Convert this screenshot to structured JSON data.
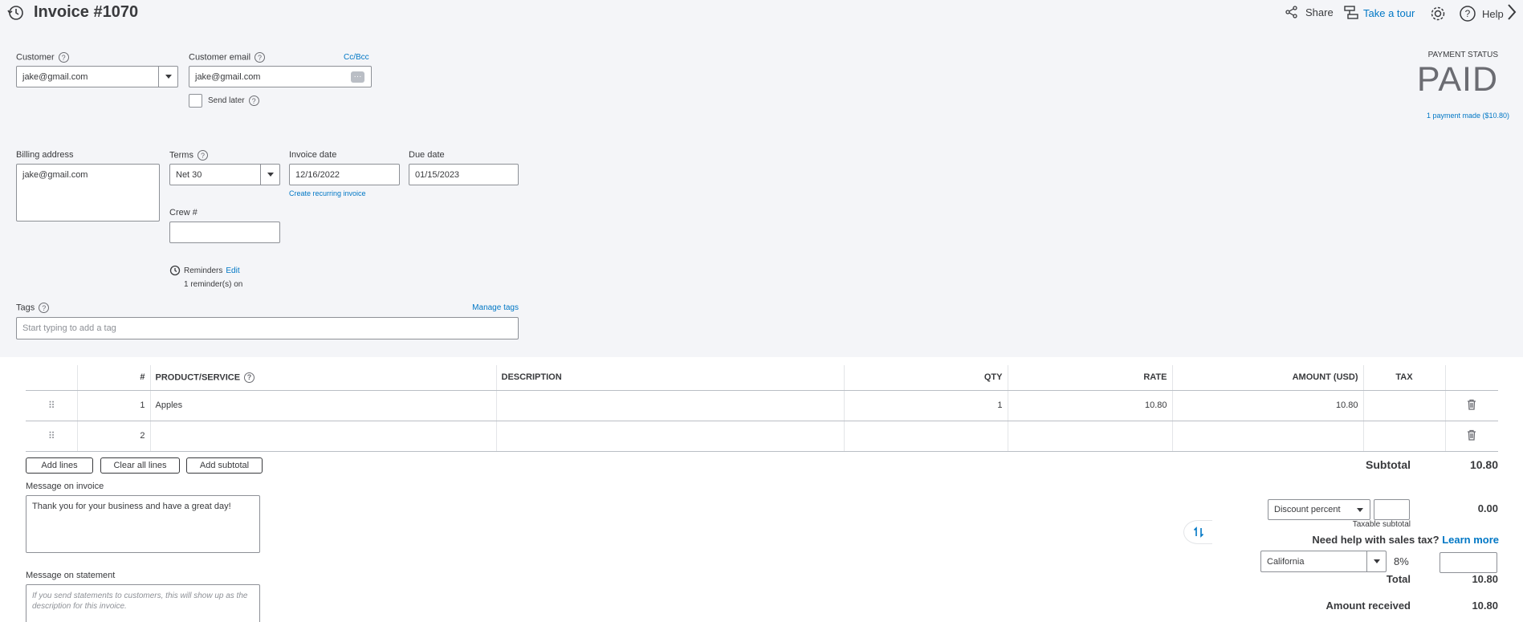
{
  "header": {
    "title": "Invoice #1070",
    "share_label": "Share",
    "tour_label": "Take a tour",
    "help_label": "Help"
  },
  "customer": {
    "label": "Customer",
    "value": "jake@gmail.com"
  },
  "email": {
    "label": "Customer email",
    "cc_bcc": "Cc/Bcc",
    "value": "jake@gmail.com",
    "send_later": "Send later"
  },
  "payment": {
    "status_label": "PAYMENT STATUS",
    "status": "PAID",
    "payments_link": "1 payment made ($10.80)"
  },
  "billing": {
    "label": "Billing address",
    "value": "jake@gmail.com"
  },
  "terms": {
    "label": "Terms",
    "value": "Net 30"
  },
  "invoice_date": {
    "label": "Invoice date",
    "value": "12/16/2022",
    "recurring_link": "Create recurring invoice"
  },
  "due_date": {
    "label": "Due date",
    "value": "01/15/2023"
  },
  "crew": {
    "label": "Crew #",
    "value": ""
  },
  "reminders": {
    "label": "Reminders",
    "edit": "Edit",
    "status": "1 reminder(s) on"
  },
  "tags": {
    "label": "Tags",
    "manage": "Manage tags",
    "placeholder": "Start typing to add a tag"
  },
  "table": {
    "columns": {
      "num": "#",
      "product": "PRODUCT/SERVICE",
      "description": "DESCRIPTION",
      "qty": "QTY",
      "rate": "RATE",
      "amount": "AMOUNT (USD)",
      "tax": "TAX"
    },
    "rows": [
      {
        "num": "1",
        "product": "Apples",
        "description": "",
        "qty": "1",
        "rate": "10.80",
        "amount": "10.80",
        "tax": ""
      },
      {
        "num": "2",
        "product": "",
        "description": "",
        "qty": "",
        "rate": "",
        "amount": "",
        "tax": ""
      }
    ]
  },
  "actions": {
    "add_lines": "Add lines",
    "clear_lines": "Clear all lines",
    "add_subtotal": "Add subtotal"
  },
  "message_invoice": {
    "label": "Message on invoice",
    "value": "Thank you for your business and have a great day!"
  },
  "message_statement": {
    "label": "Message on statement",
    "placeholder": "If you send statements to customers, this will show up as the description for this invoice."
  },
  "totals": {
    "subtotal_label": "Subtotal",
    "subtotal": "10.80",
    "discount_type": "Discount percent",
    "discount_value": "",
    "discount_amount": "0.00",
    "taxable_subtotal": "Taxable subtotal",
    "tax_help": "Need help with sales tax?",
    "learn_more": "Learn more",
    "tax_region": "California",
    "tax_rate": "8%",
    "tax_amount": "",
    "total_label": "Total",
    "total": "10.80",
    "received_label": "Amount received",
    "received": "10.80"
  }
}
